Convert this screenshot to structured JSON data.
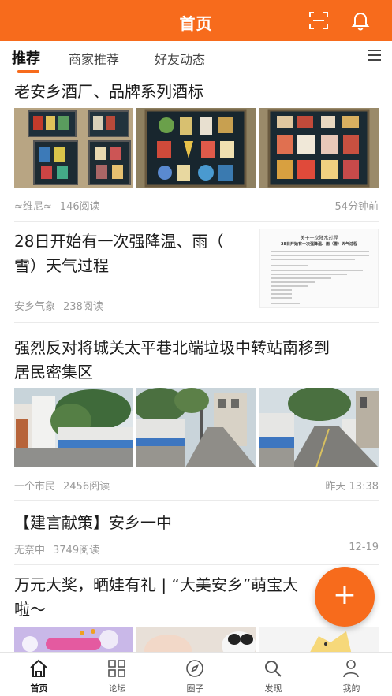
{
  "header": {
    "title": "首页",
    "accent": "#f76b1c"
  },
  "tabs": [
    {
      "label": "推荐",
      "active": true
    },
    {
      "label": "商家推荐",
      "active": false
    },
    {
      "label": "好友动态",
      "active": false
    }
  ],
  "feed": [
    {
      "title": "老安乡酒厂、品牌系列酒标",
      "author": "≈维尼≈",
      "reads": "146阅读",
      "time": "54分钟前"
    },
    {
      "title_line1": "28日开始有一次强降温、雨（",
      "title_line2": "雪）天气过程",
      "author": "安乡气象",
      "reads": "238阅读",
      "time": ""
    },
    {
      "title_line1": "强烈反对将城关太平巷北端垃圾中转站南移到",
      "title_line2": "居民密集区",
      "author": "一个市民",
      "reads": "2456阅读",
      "time": "昨天 13:38"
    },
    {
      "title": "【建言献策】安乡一中",
      "author": "无奈中",
      "reads": "3749阅读",
      "time": "12-19"
    },
    {
      "title_line1": "万元大奖，晒娃有礼 | “大美安乡”萌宝大",
      "title_line2": "啦～"
    }
  ],
  "doc_thumb": {
    "heading": "关于一次降水过程",
    "subheading": "28日开始有一次强降温、雨（雪）天气过程"
  },
  "fab": {
    "label": "+"
  },
  "bottom_nav": [
    {
      "label": "首页",
      "icon": "home-icon",
      "active": true
    },
    {
      "label": "论坛",
      "icon": "grid-icon",
      "active": false
    },
    {
      "label": "圈子",
      "icon": "compass-icon",
      "active": false
    },
    {
      "label": "发现",
      "icon": "search-icon",
      "active": false
    },
    {
      "label": "我的",
      "icon": "person-icon",
      "active": false
    }
  ]
}
